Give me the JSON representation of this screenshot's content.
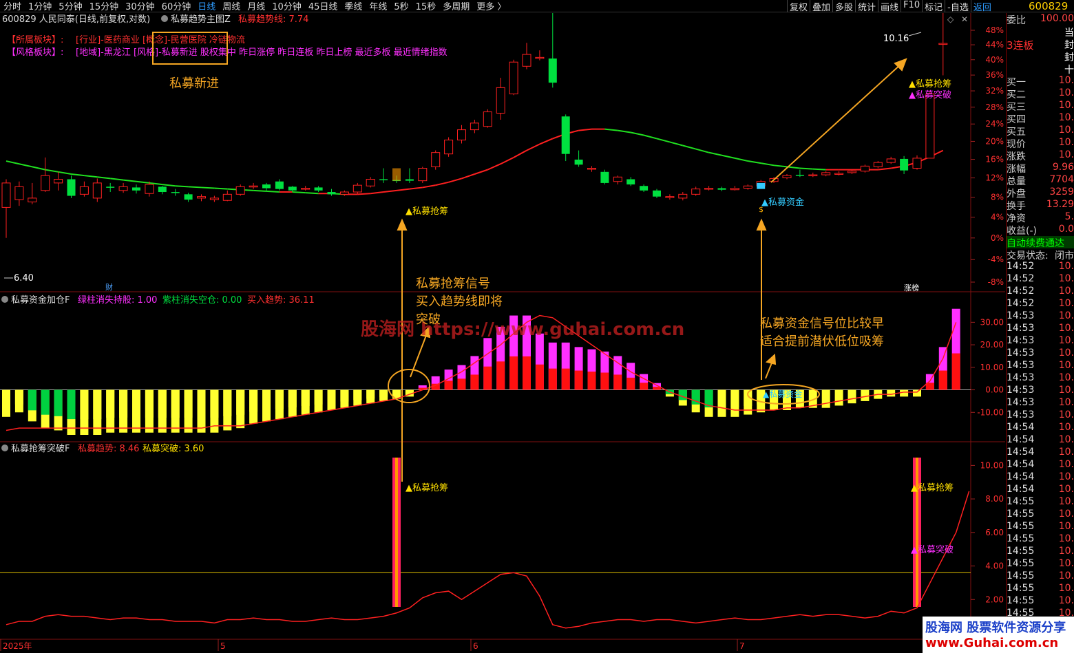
{
  "toolbar": {
    "periods": [
      "分时",
      "1分钟",
      "5分钟",
      "15分钟",
      "30分钟",
      "60分钟",
      "日线",
      "周线",
      "月线",
      "10分钟",
      "45日线",
      "季线",
      "年线",
      "5秒",
      "15秒",
      "多周期",
      "更多 〉"
    ],
    "active_period": "日线",
    "tools": [
      "复权",
      "叠加",
      "多股",
      "统计",
      "画线",
      "F10",
      "标记",
      "-自选",
      "返回"
    ],
    "code": "600829"
  },
  "main_panel": {
    "title": "600829 人民同泰(日线,前复权,对数)",
    "indicator_name": "私募趋势主图Z",
    "indicator_value": "私募趋势线: 7.74",
    "sector_label": "【所属板块】:",
    "sector_text": "[行业]-医药商业 [概念]-民营医院 冷链物流",
    "style_label": "【风格板块】:",
    "style_text": "[地域]-黑龙江 [风格]-私募新进 股权集中 昨日涨停 昨日连板 昨日上榜 最近多板 最近情绪指数",
    "note_new": "私募新进",
    "high_price": "10.16",
    "low_price": "6.40",
    "cai_badge": "财",
    "zb_badge": "涨榜",
    "signal_qiangchou": "私募抢筹",
    "signal_zijin": "私募资金",
    "signal_tupo": "私募突破",
    "pct_axis": [
      "48%",
      "44%",
      "40%",
      "36%",
      "32%",
      "28%",
      "24%",
      "20%",
      "16%",
      "12%",
      "8%",
      "4%",
      "0%",
      "-4%",
      "-8%"
    ],
    "colors": {
      "up": "#ff2020",
      "down": "#00e040",
      "ma_up": "#ff2020",
      "ma_down": "#20e020"
    }
  },
  "mid_panel": {
    "title": "私募资金加仓F",
    "v1": "绿柱消失持股: 1.00",
    "v2": "紫柱消失空仓: 0.00",
    "v3": "买入趋势: 36.11",
    "axis": [
      "30.00",
      "20.00",
      "10.00",
      "0.00",
      "-10.00"
    ],
    "annot1_l1": "私募抢筹信号",
    "annot1_l2": "买入趋势线即将",
    "annot1_l3": "突破",
    "annot2_l1": "私募资金信号位比较早",
    "annot2_l2": "适合提前潜伏低位吸筹",
    "watermark": "股海网 https://www.guhai.com.cn",
    "signal_zijin": "私募资金"
  },
  "bottom_panel": {
    "title": "私募抢筹突破F",
    "v1": "私募趋势: 8.46",
    "v2": "私募突破: 3.60",
    "axis": [
      "10.00",
      "8.00",
      "6.00",
      "4.00",
      "2.00"
    ],
    "signal_qiangchou": "私募抢筹",
    "signal_tupo": "私募突破",
    "date_labels": [
      "2025年",
      "5",
      "6",
      "7"
    ]
  },
  "chart_data": {
    "type": "candlestick",
    "candles": [
      {
        "o": 6.78,
        "c": 7.1,
        "h": 7.15,
        "l": 6.4
      },
      {
        "o": 6.88,
        "c": 7.05,
        "h": 7.12,
        "l": 6.8
      },
      {
        "o": 6.85,
        "c": 6.9,
        "h": 7.1,
        "l": 6.82
      },
      {
        "o": 7.0,
        "c": 7.2,
        "h": 7.45,
        "l": 6.98
      },
      {
        "o": 7.1,
        "c": 7.15,
        "h": 7.25,
        "l": 7.0
      },
      {
        "o": 7.15,
        "c": 6.93,
        "h": 7.2,
        "l": 6.9
      },
      {
        "o": 6.95,
        "c": 7.05,
        "h": 7.12,
        "l": 6.92
      },
      {
        "o": 6.9,
        "c": 7.1,
        "h": 7.16,
        "l": 6.85
      },
      {
        "o": 7.05,
        "c": 7.04,
        "h": 7.1,
        "l": 6.98
      },
      {
        "o": 7.0,
        "c": 7.05,
        "h": 7.1,
        "l": 6.97
      },
      {
        "o": 7.04,
        "c": 7.0,
        "h": 7.08,
        "l": 6.96
      },
      {
        "o": 6.96,
        "c": 7.08,
        "h": 7.12,
        "l": 6.92
      },
      {
        "o": 7.05,
        "c": 6.98,
        "h": 7.06,
        "l": 6.95
      },
      {
        "o": 6.98,
        "c": 6.97,
        "h": 7.02,
        "l": 6.93
      },
      {
        "o": 6.95,
        "c": 6.88,
        "h": 6.97,
        "l": 6.85
      },
      {
        "o": 6.9,
        "c": 6.92,
        "h": 6.95,
        "l": 6.86
      },
      {
        "o": 6.88,
        "c": 6.9,
        "h": 6.93,
        "l": 6.85
      },
      {
        "o": 6.87,
        "c": 6.95,
        "h": 7.0,
        "l": 6.86
      },
      {
        "o": 6.95,
        "c": 7.05,
        "h": 7.08,
        "l": 6.93
      },
      {
        "o": 7.05,
        "c": 7.06,
        "h": 7.1,
        "l": 7.02
      },
      {
        "o": 7.08,
        "c": 7.03,
        "h": 7.1,
        "l": 7.0
      },
      {
        "o": 7.12,
        "c": 7.02,
        "h": 7.15,
        "l": 7.0
      },
      {
        "o": 7.05,
        "c": 7.0,
        "h": 7.06,
        "l": 6.98
      },
      {
        "o": 7.02,
        "c": 7.03,
        "h": 7.06,
        "l": 7.0
      },
      {
        "o": 7.04,
        "c": 7.0,
        "h": 7.06,
        "l": 6.98
      },
      {
        "o": 6.98,
        "c": 6.95,
        "h": 7.02,
        "l": 6.93
      },
      {
        "o": 6.95,
        "c": 6.98,
        "h": 7.0,
        "l": 6.93
      },
      {
        "o": 6.98,
        "c": 7.07,
        "h": 7.1,
        "l": 6.95
      },
      {
        "o": 7.06,
        "c": 7.15,
        "h": 7.18,
        "l": 7.04
      },
      {
        "o": 7.15,
        "c": 7.14,
        "h": 7.3,
        "l": 7.1
      },
      {
        "o": 7.14,
        "c": 7.13,
        "h": 7.2,
        "l": 7.1
      },
      {
        "o": 7.15,
        "c": 7.13,
        "h": 7.3,
        "l": 7.1
      },
      {
        "o": 7.13,
        "c": 7.3,
        "h": 7.32,
        "l": 7.1
      },
      {
        "o": 7.32,
        "c": 7.52,
        "h": 7.55,
        "l": 7.28
      },
      {
        "o": 7.5,
        "c": 7.7,
        "h": 7.74,
        "l": 7.46
      },
      {
        "o": 7.7,
        "c": 7.85,
        "h": 7.92,
        "l": 7.65
      },
      {
        "o": 7.85,
        "c": 7.95,
        "h": 8.0,
        "l": 7.8
      },
      {
        "o": 7.9,
        "c": 8.12,
        "h": 8.16,
        "l": 7.88
      },
      {
        "o": 8.1,
        "c": 8.5,
        "h": 8.66,
        "l": 8.0
      },
      {
        "o": 8.4,
        "c": 8.92,
        "h": 8.96,
        "l": 8.38
      },
      {
        "o": 8.85,
        "c": 9.05,
        "h": 9.25,
        "l": 8.8
      },
      {
        "o": 9.0,
        "c": 9.0,
        "h": 9.12,
        "l": 8.95
      },
      {
        "o": 8.98,
        "c": 8.58,
        "h": 9.92,
        "l": 8.5
      },
      {
        "o": 8.05,
        "c": 7.5,
        "h": 8.08,
        "l": 7.4
      },
      {
        "o": 7.42,
        "c": 7.35,
        "h": 7.55,
        "l": 7.32
      },
      {
        "o": 7.3,
        "c": 7.3,
        "h": 7.33,
        "l": 7.25
      },
      {
        "o": 7.25,
        "c": 7.1,
        "h": 7.28,
        "l": 7.08
      },
      {
        "o": 7.12,
        "c": 7.18,
        "h": 7.2,
        "l": 7.08
      },
      {
        "o": 7.15,
        "c": 7.08,
        "h": 7.18,
        "l": 7.06
      },
      {
        "o": 7.06,
        "c": 7.0,
        "h": 7.08,
        "l": 6.98
      },
      {
        "o": 7.0,
        "c": 6.92,
        "h": 7.02,
        "l": 6.9
      },
      {
        "o": 6.92,
        "c": 6.92,
        "h": 6.95,
        "l": 6.88
      },
      {
        "o": 6.9,
        "c": 6.95,
        "h": 6.98,
        "l": 6.87
      },
      {
        "o": 6.95,
        "c": 7.02,
        "h": 7.05,
        "l": 6.93
      },
      {
        "o": 7.02,
        "c": 7.03,
        "h": 7.06,
        "l": 7.0
      },
      {
        "o": 7.03,
        "c": 7.01,
        "h": 7.05,
        "l": 6.99
      },
      {
        "o": 7.01,
        "c": 7.03,
        "h": 7.06,
        "l": 7.0
      },
      {
        "o": 7.03,
        "c": 7.06,
        "h": 7.08,
        "l": 7.01
      },
      {
        "o": 7.06,
        "c": 7.12,
        "h": 7.14,
        "l": 7.04
      },
      {
        "o": 7.12,
        "c": 7.16,
        "h": 7.18,
        "l": 7.1
      },
      {
        "o": 7.17,
        "c": 7.2,
        "h": 7.22,
        "l": 7.15
      },
      {
        "o": 7.21,
        "c": 7.2,
        "h": 7.28,
        "l": 7.18
      },
      {
        "o": 7.2,
        "c": 7.21,
        "h": 7.24,
        "l": 7.18
      },
      {
        "o": 7.21,
        "c": 7.24,
        "h": 7.26,
        "l": 7.19
      },
      {
        "o": 7.23,
        "c": 7.23,
        "h": 7.26,
        "l": 7.2
      },
      {
        "o": 7.24,
        "c": 7.26,
        "h": 7.28,
        "l": 7.22
      },
      {
        "o": 7.26,
        "c": 7.33,
        "h": 7.35,
        "l": 7.24
      },
      {
        "o": 7.32,
        "c": 7.38,
        "h": 7.4,
        "l": 7.3
      },
      {
        "o": 7.38,
        "c": 7.43,
        "h": 7.46,
        "l": 7.36
      },
      {
        "o": 7.43,
        "c": 7.27,
        "h": 7.47,
        "l": 7.22
      },
      {
        "o": 7.3,
        "c": 7.44,
        "h": 7.48,
        "l": 7.28
      },
      {
        "o": 7.44,
        "c": 8.4,
        "h": 8.44,
        "l": 7.44
      },
      {
        "o": 9.24,
        "c": 9.24,
        "h": 10.16,
        "l": 8.7
      }
    ],
    "ma": [
      7.4,
      7.36,
      7.32,
      7.28,
      7.25,
      7.22,
      7.2,
      7.18,
      7.16,
      7.14,
      7.12,
      7.1,
      7.08,
      7.06,
      7.05,
      7.04,
      7.03,
      7.02,
      7.01,
      7.0,
      6.99,
      6.98,
      6.98,
      6.97,
      6.96,
      6.96,
      6.95,
      6.95,
      6.96,
      6.98,
      7.0,
      7.02,
      7.04,
      7.07,
      7.11,
      7.16,
      7.22,
      7.28,
      7.36,
      7.45,
      7.55,
      7.64,
      7.72,
      7.79,
      7.84,
      7.86,
      7.86,
      7.84,
      7.81,
      7.77,
      7.72,
      7.67,
      7.62,
      7.57,
      7.52,
      7.48,
      7.44,
      7.4,
      7.37,
      7.34,
      7.32,
      7.3,
      7.29,
      7.28,
      7.28,
      7.28,
      7.28,
      7.28,
      7.3,
      7.33,
      7.38,
      7.46,
      7.55
    ],
    "mid_bars": [
      -12,
      -10,
      -14,
      -17,
      -18,
      -20,
      -20,
      -20,
      -19,
      -19,
      -19,
      -19,
      -19,
      -19,
      -19,
      -19,
      -19,
      -18,
      -17,
      -15,
      -14,
      -13,
      -12,
      -11,
      -10,
      -9,
      -8,
      -7,
      -6,
      -5,
      -4,
      -3,
      2,
      6,
      9,
      11,
      15,
      23,
      28,
      33,
      33,
      25,
      21,
      21,
      19,
      18,
      17,
      15,
      12,
      7,
      3,
      -3,
      -7,
      -10,
      -12,
      -12,
      -12,
      -11,
      -10,
      -9,
      -9,
      -8,
      -8,
      -8,
      -7,
      -6,
      -5,
      -4,
      -3,
      -3,
      -3,
      7,
      19,
      36
    ],
    "mid_line": [
      -18,
      -17,
      -17,
      -17,
      -17,
      -17,
      -17,
      -17,
      -17,
      -17,
      -17,
      -17,
      -17,
      -17,
      -17,
      -17,
      -16,
      -16,
      -16,
      -15,
      -14,
      -13,
      -12,
      -11,
      -10,
      -9,
      -8,
      -7,
      -6,
      -5,
      -4,
      -2,
      0,
      2,
      5,
      8,
      12,
      16,
      20,
      25,
      30,
      33,
      32,
      28,
      24,
      20,
      16,
      12,
      8,
      5,
      2,
      -1,
      -3,
      -5,
      -7,
      -8,
      -9,
      -9,
      -9,
      -9,
      -8,
      -8,
      -7,
      -6,
      -5,
      -4,
      -3,
      -2,
      -2,
      -1,
      -1,
      4,
      14,
      30
    ],
    "mid_ylim": [
      -20,
      35
    ],
    "bottom_line": [
      0.5,
      0.7,
      0.7,
      1.0,
      1.1,
      1.0,
      1.0,
      0.9,
      0.8,
      0.9,
      0.9,
      0.8,
      0.8,
      0.7,
      0.7,
      0.7,
      0.6,
      0.8,
      0.8,
      0.9,
      0.8,
      0.8,
      0.7,
      0.7,
      0.8,
      0.9,
      0.8,
      0.8,
      0.9,
      1.0,
      1.2,
      1.5,
      2.1,
      2.4,
      2.5,
      2.0,
      2.5,
      3.0,
      3.5,
      3.6,
      3.4,
      2.2,
      0.5,
      0.3,
      0.4,
      0.6,
      0.7,
      0.8,
      0.8,
      0.7,
      0.8,
      0.8,
      0.7,
      0.6,
      0.7,
      0.8,
      0.9,
      0.8,
      0.8,
      0.9,
      1.0,
      1.1,
      1.0,
      1.1,
      1.1,
      1.0,
      0.9,
      1.0,
      1.3,
      1.2,
      1.5,
      3.0,
      4.5,
      6.0,
      8.46
    ],
    "bottom_threshold": 3.6,
    "bottom_ylim": [
      0,
      11
    ]
  },
  "sidebar": {
    "code": "600829",
    "rows": [
      {
        "l": "委比",
        "v": "100.00"
      },
      {
        "l": "",
        "v": "当"
      },
      {
        "l": "3连板",
        "v": "封"
      },
      {
        "l": "",
        "v": "封"
      },
      {
        "l": "",
        "v": "十"
      },
      {
        "l": "买一",
        "v": "10."
      },
      {
        "l": "买二",
        "v": "10."
      },
      {
        "l": "买三",
        "v": "10."
      },
      {
        "l": "买四",
        "v": "10."
      },
      {
        "l": "买五",
        "v": "10."
      },
      {
        "l": "现价",
        "v": "10."
      },
      {
        "l": "涨跌",
        "v": "10."
      },
      {
        "l": "涨幅",
        "v": "9.96"
      },
      {
        "l": "总量",
        "v": "7704"
      },
      {
        "l": "外盘",
        "v": "3259"
      },
      {
        "l": "换手",
        "v": "13.29"
      },
      {
        "l": "净资",
        "v": "5."
      },
      {
        "l": "收益(-)",
        "v": "0.0"
      },
      {
        "l": "自动续费通达",
        "v": ""
      },
      {
        "l": "交易状态:",
        "v": "闭市"
      }
    ],
    "ticks": [
      "14:52",
      "14:52",
      "14:52",
      "14:52",
      "14:53",
      "14:53",
      "14:53",
      "14:53",
      "14:53",
      "14:53",
      "14:53",
      "14:53",
      "14:53",
      "14:54",
      "14:54",
      "14:54",
      "14:54",
      "14:54",
      "14:54",
      "14:55",
      "14:55",
      "14:55",
      "14:55",
      "14:55",
      "14:55",
      "14:55",
      "14:55",
      "14:55",
      "14:55"
    ],
    "tick_price": "10."
  },
  "logo": {
    "line1": "股海网 股票软件资源分享",
    "line2": "www.Guhai.com.cn"
  }
}
